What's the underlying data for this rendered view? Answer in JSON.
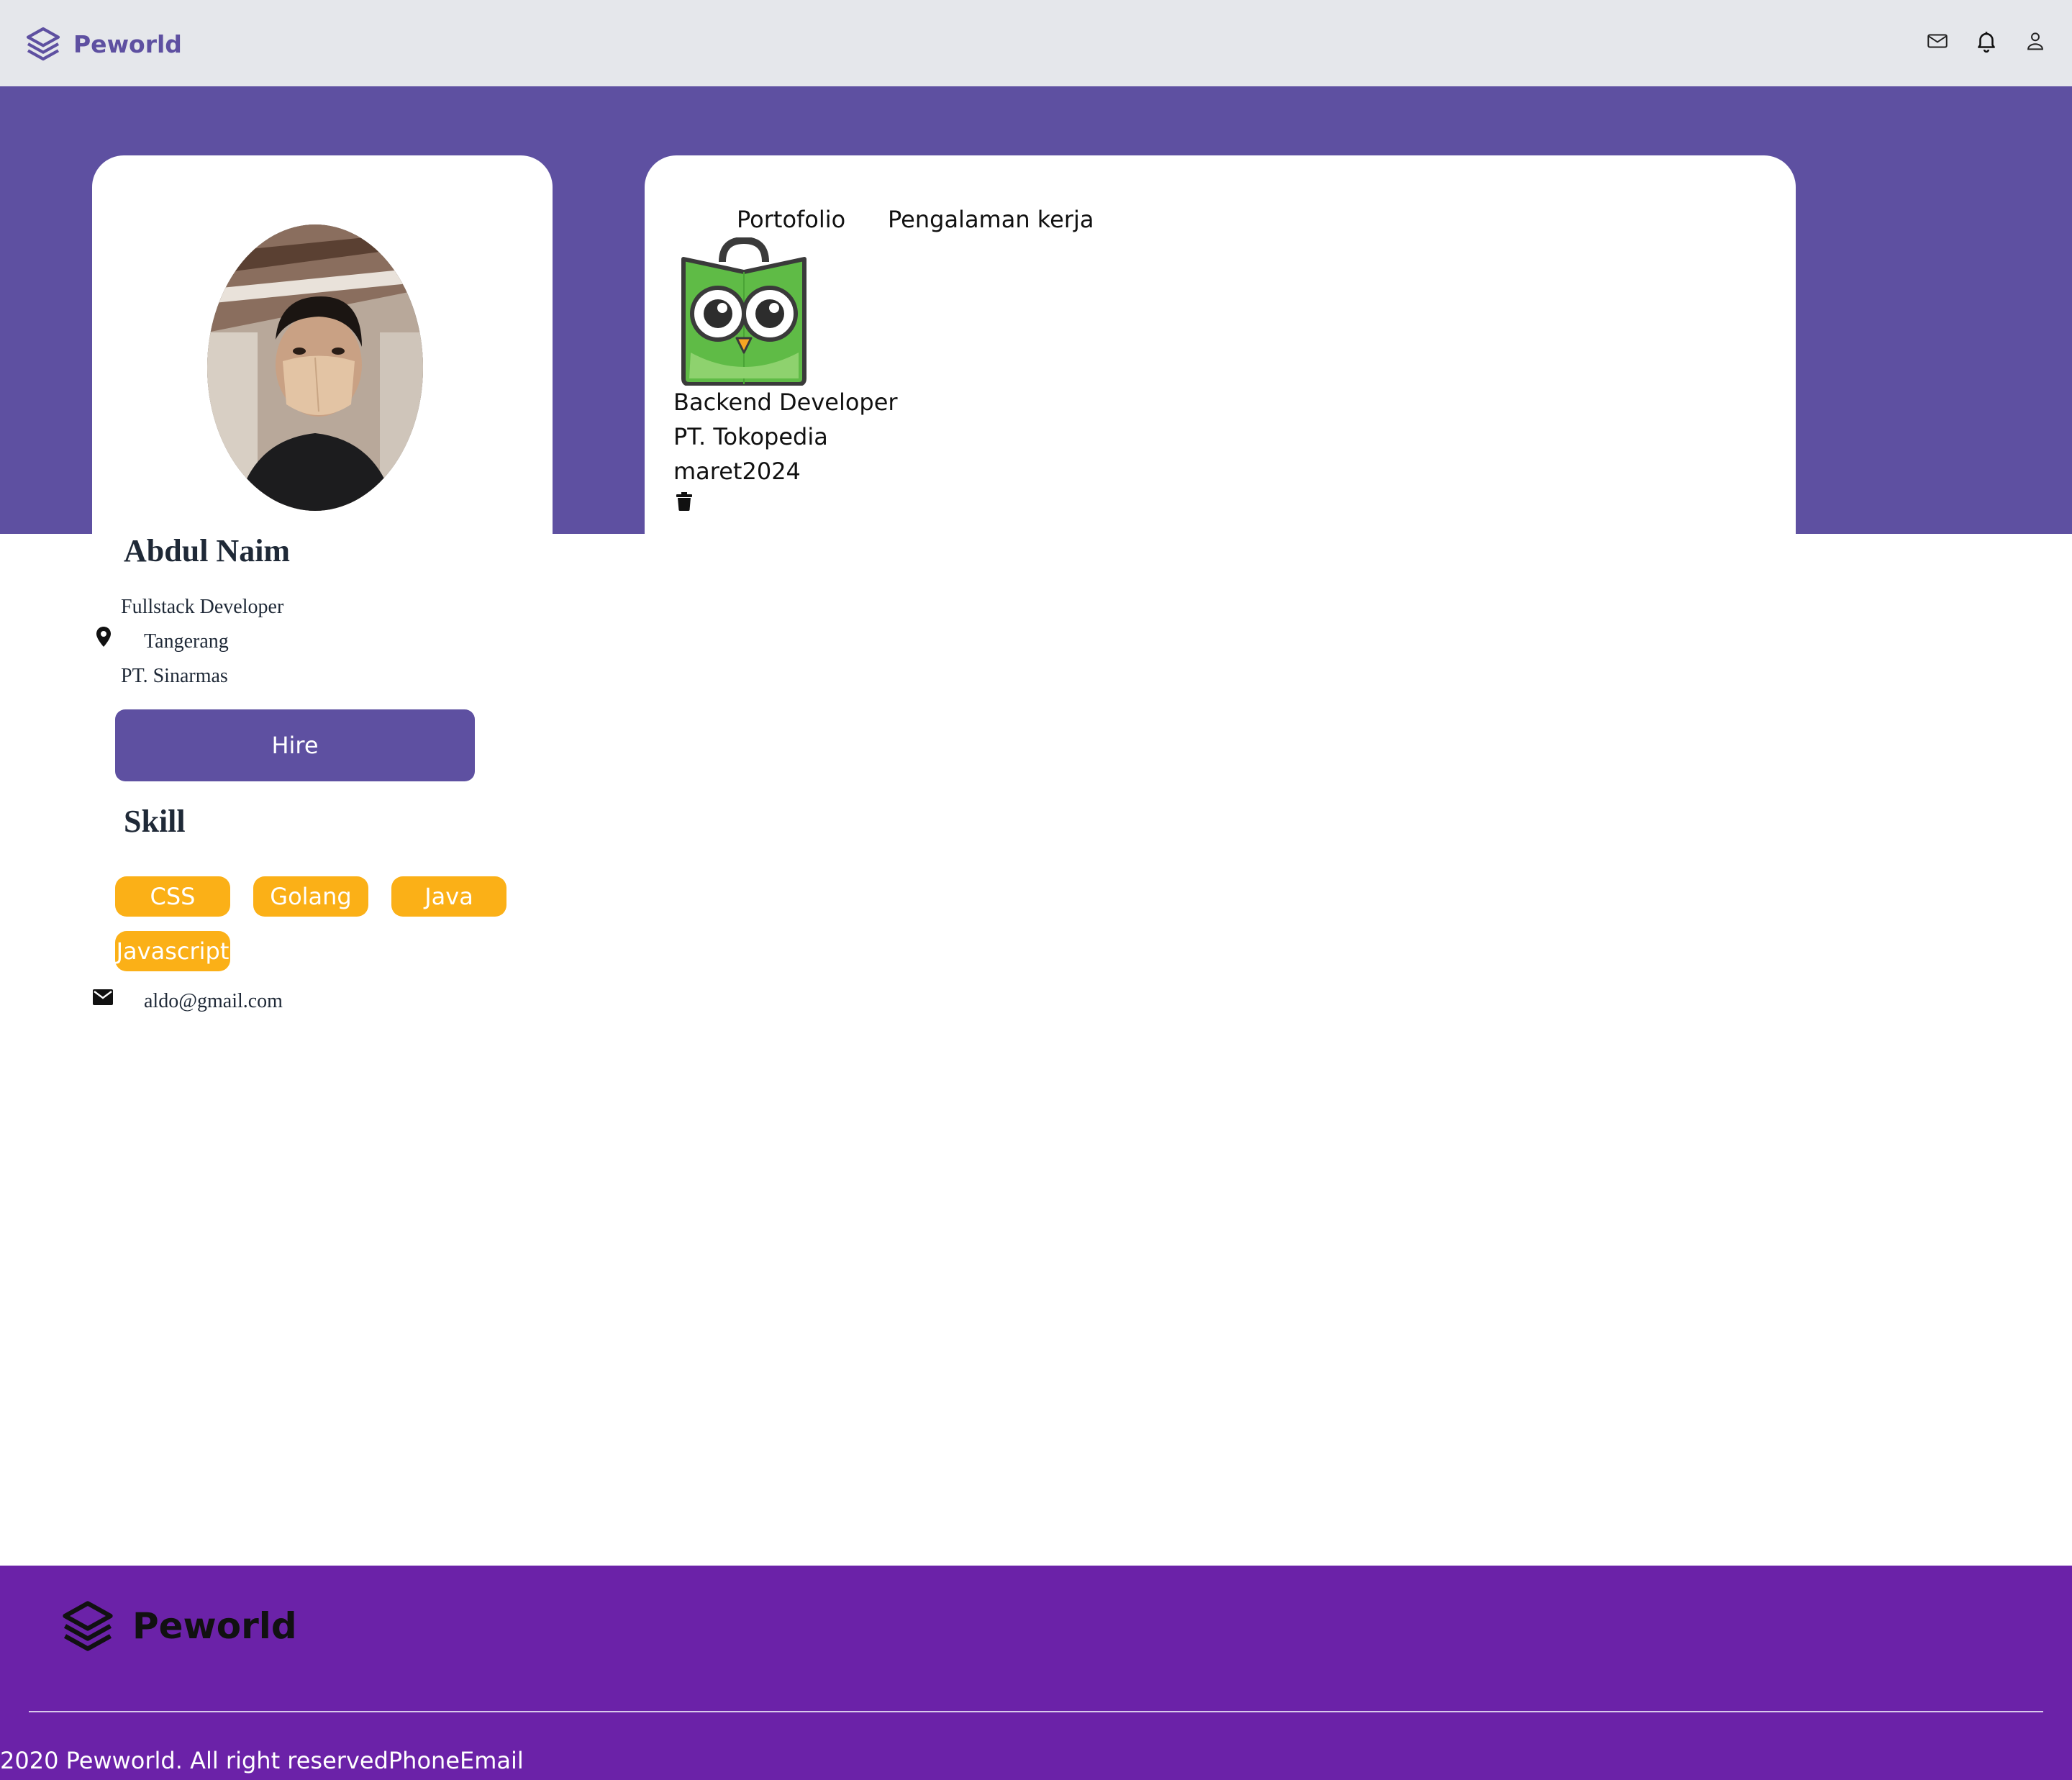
{
  "navbar": {
    "brand": "Peworld",
    "icons": [
      "mail-icon",
      "bell-icon",
      "user-icon"
    ]
  },
  "profile": {
    "name": "Abdul Naim",
    "job": "Fullstack Developer",
    "location": "Tangerang",
    "company": "PT. Sinarmas",
    "hire_label": "Hire",
    "skill_title": "Skill",
    "skills": [
      "CSS",
      "Golang",
      "Java",
      "Javascript"
    ],
    "email": "aldo@gmail.com"
  },
  "tabs": {
    "portfolio": "Portofolio",
    "experience": "Pengalaman kerja"
  },
  "experience": {
    "position": "Backend Developer",
    "company": "PT. Tokopedia",
    "date": "maret2024"
  },
  "footer": {
    "brand": "Peworld",
    "copyright": "2020 Pewworld. All right reserved",
    "phone": "Phone",
    "email": "Email"
  },
  "colors": {
    "primary": "#5e50a1",
    "skill_badge": "#fbb017",
    "footer_bg": "#6b22a8",
    "navbar_bg": "#e5e7eb"
  }
}
